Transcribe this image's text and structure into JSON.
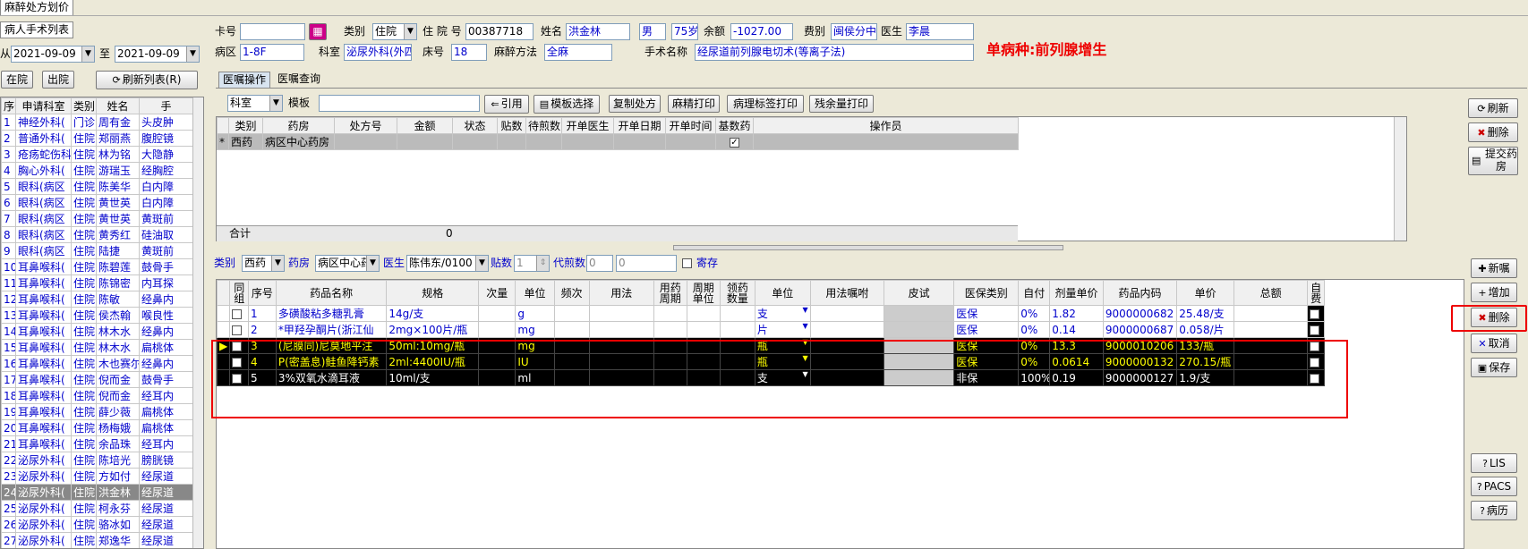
{
  "window": {
    "title": "麻醉处方划价"
  },
  "left": {
    "tab": "病人手术列表",
    "from_label": "从",
    "date_from": "2021-09-09",
    "to_label": "至",
    "date_to": "2021-09-09",
    "btn_inpatient": "在院",
    "btn_discharged": "出院",
    "btn_refresh": "刷新列表(R)",
    "columns": [
      "序号",
      "申请科室",
      "类别",
      "姓名",
      "手"
    ],
    "patients": [
      {
        "no": "1",
        "dept": "神经外科(",
        "type": "门诊",
        "name": "周有金",
        "op": "头皮肿"
      },
      {
        "no": "2",
        "dept": "普通外科(",
        "type": "住院",
        "name": "郑丽燕",
        "op": "腹腔镜"
      },
      {
        "no": "3",
        "dept": "疮疡蛇伤科",
        "type": "住院",
        "name": "林为铭",
        "op": "大隐静"
      },
      {
        "no": "4",
        "dept": "胸心外科(",
        "type": "住院",
        "name": "游瑞玉",
        "op": "经胸腔"
      },
      {
        "no": "5",
        "dept": "眼科(病区",
        "type": "住院",
        "name": "陈美华",
        "op": "白内障"
      },
      {
        "no": "6",
        "dept": "眼科(病区",
        "type": "住院",
        "name": "黄世英",
        "op": "白内障"
      },
      {
        "no": "7",
        "dept": "眼科(病区",
        "type": "住院",
        "name": "黄世英",
        "op": "黄斑前"
      },
      {
        "no": "8",
        "dept": "眼科(病区",
        "type": "住院",
        "name": "黄秀红",
        "op": "硅油取"
      },
      {
        "no": "9",
        "dept": "眼科(病区",
        "type": "住院",
        "name": "陆捷",
        "op": "黄斑前"
      },
      {
        "no": "10",
        "dept": "耳鼻喉科(",
        "type": "住院",
        "name": "陈碧莲",
        "op": "鼓骨手"
      },
      {
        "no": "11",
        "dept": "耳鼻喉科(",
        "type": "住院",
        "name": "陈锦密",
        "op": "内耳探"
      },
      {
        "no": "12",
        "dept": "耳鼻喉科(",
        "type": "住院",
        "name": "陈敏",
        "op": "经鼻内"
      },
      {
        "no": "13",
        "dept": "耳鼻喉科(",
        "type": "住院",
        "name": "侯杰翰",
        "op": "喉良性"
      },
      {
        "no": "14",
        "dept": "耳鼻喉科(",
        "type": "住院",
        "name": "林木水",
        "op": "经鼻内"
      },
      {
        "no": "15",
        "dept": "耳鼻喉科(",
        "type": "住院",
        "name": "林木水",
        "op": "扁桃体"
      },
      {
        "no": "16",
        "dept": "耳鼻喉科(",
        "type": "住院",
        "name": "木也赛尔",
        "op": "经鼻内"
      },
      {
        "no": "17",
        "dept": "耳鼻喉科(",
        "type": "住院",
        "name": "倪而金",
        "op": "鼓骨手"
      },
      {
        "no": "18",
        "dept": "耳鼻喉科(",
        "type": "住院",
        "name": "倪而金",
        "op": "经耳内"
      },
      {
        "no": "19",
        "dept": "耳鼻喉科(",
        "type": "住院",
        "name": "薛少薇",
        "op": "扁桃体"
      },
      {
        "no": "20",
        "dept": "耳鼻喉科(",
        "type": "住院",
        "name": "杨梅娥",
        "op": "扁桃体"
      },
      {
        "no": "21",
        "dept": "耳鼻喉科(",
        "type": "住院",
        "name": "余品珠",
        "op": "经耳内"
      },
      {
        "no": "22",
        "dept": "泌尿外科(",
        "type": "住院",
        "name": "陈培光",
        "op": "膀胱镜"
      },
      {
        "no": "23",
        "dept": "泌尿外科(",
        "type": "住院",
        "name": "方如付",
        "op": "经尿道"
      },
      {
        "no": "24",
        "dept": "泌尿外科(",
        "type": "住院",
        "name": "洪金林",
        "op": "经尿道"
      },
      {
        "no": "25",
        "dept": "泌尿外科(",
        "type": "住院",
        "name": "柯永芬",
        "op": "经尿道"
      },
      {
        "no": "26",
        "dept": "泌尿外科(",
        "type": "住院",
        "name": "骆冰如",
        "op": "经尿道"
      },
      {
        "no": "27",
        "dept": "泌尿外科(",
        "type": "住院",
        "name": "郑逸华",
        "op": "经尿道"
      }
    ]
  },
  "header": {
    "card_label": "卡号",
    "card_value": "",
    "type_label": "类别",
    "type_value": "住院",
    "inpatient_label": "住 院 号",
    "inpatient_value": "00387718",
    "name_label": "姓名",
    "name_value": "洪金林",
    "sex": "男",
    "age": "75岁",
    "balance_label": "余额",
    "balance_value": "-1027.00",
    "fee_label": "费别",
    "fee_value": "闽侯分中",
    "doctor_label": "医生",
    "doctor_value": "李晨",
    "ward_label": "病区",
    "ward_value": "1-8F",
    "dept_label": "科室",
    "dept_value": "泌尿外科(外四",
    "bed_label": "床号",
    "bed_value": "18",
    "anes_label": "麻醉方法",
    "anes_value": "全麻",
    "surgery_label": "手术名称",
    "surgery_value": "经尿道前列腺电切术(等离子法)",
    "disease": "单病种:前列腺增生"
  },
  "tabs": [
    "医嘱操作",
    "医嘱查询"
  ],
  "toolbar": {
    "dept_value": "科室",
    "template_label": "模板",
    "btn_cite": "引用",
    "btn_template": "模板选择",
    "btn_copy": "复制处方",
    "btn_anes_print": "麻精打印",
    "btn_label_print": "病理标签打印",
    "btn_remain_print": "残余量打印"
  },
  "rx_table": {
    "columns": [
      "类别",
      "药房",
      "处方号",
      "金额",
      "状态",
      "贴数",
      "待煎数",
      "开单医生",
      "开单日期",
      "开单时间",
      "基数药",
      "操作员"
    ],
    "row": {
      "marker": "*",
      "type": "西药",
      "pharmacy": "病区中心药房"
    },
    "total_label": "合计",
    "total_value": "0"
  },
  "right_top": {
    "refresh": "刷新",
    "delete": "删除",
    "submit": "提交药房"
  },
  "detail_bar": {
    "type_label": "类别",
    "type_value": "西药",
    "pharmacy_label": "药房",
    "pharmacy_value": "病区中心药",
    "doctor_label": "医生",
    "doctor_value": "陈伟东/0100",
    "doses_label": "贴数",
    "doses_value": "1",
    "decoct_label": "代煎数",
    "decoct_value": "0",
    "decoct_value2": "0",
    "deposit_label": "寄存"
  },
  "drug_table": {
    "columns": [
      "同组",
      "序号",
      "药品名称",
      "规格",
      "次量",
      "单位",
      "频次",
      "用法",
      "用药周期",
      "周期单位",
      "领药数量",
      "单位",
      "用法嘱咐",
      "皮试",
      "医保类别",
      "自付",
      "剂量单价",
      "药品内码",
      "单价",
      "总额",
      "自费"
    ],
    "rows": [
      {
        "no": "1",
        "name": "多磺酸粘多糖乳膏",
        "spec": "14g/支",
        "unit": "g",
        "unit2": "支",
        "ins": "医保",
        "self": "0%",
        "dose_price": "1.82",
        "code": "9000000682",
        "price": "25.48/支",
        "style": "white"
      },
      {
        "no": "2",
        "name": "*甲羟孕酮片(浙江仙",
        "spec": "2mg×100片/瓶",
        "unit": "mg",
        "unit2": "片",
        "ins": "医保",
        "self": "0%",
        "dose_price": "0.14",
        "code": "9000000687",
        "price": "0.058/片",
        "style": "white"
      },
      {
        "no": "3",
        "name": "(尼膜同)尼莫地平注",
        "spec": "50ml:10mg/瓶",
        "unit": "mg",
        "unit2": "瓶",
        "ins": "医保",
        "self": "0%",
        "dose_price": "13.3",
        "code": "9000010206",
        "price": "133/瓶",
        "style": "yellow"
      },
      {
        "no": "4",
        "name": "P(密盖息)鲑鱼降钙素",
        "spec": "2ml:4400IU/瓶",
        "unit": "IU",
        "unit2": "瓶",
        "ins": "医保",
        "self": "0%",
        "dose_price": "0.0614",
        "code": "9000000132",
        "price": "270.15/瓶",
        "style": "yellow"
      },
      {
        "no": "5",
        "name": "3%双氧水滴耳液",
        "spec": "10ml/支",
        "unit": "ml",
        "unit2": "支",
        "ins": "非保",
        "self": "100%",
        "dose_price": "0.19",
        "code": "9000000127",
        "price": "1.9/支",
        "style": "white-on-black"
      }
    ]
  },
  "right_bottom": {
    "new": "新嘱",
    "add": "增加",
    "delete": "删除",
    "cancel": "取消",
    "save": "保存",
    "lis": "LIS",
    "pacs": "PACS",
    "history": "病历"
  }
}
